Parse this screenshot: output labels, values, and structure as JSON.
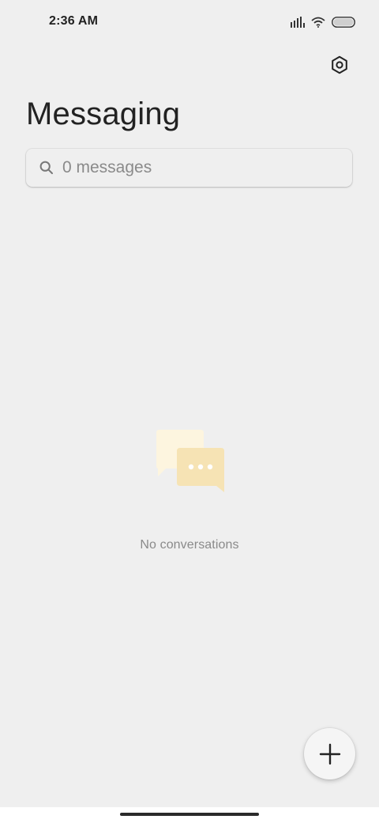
{
  "status_bar": {
    "time": "2:36 AM",
    "icons": [
      "signal-icon",
      "wifi-icon",
      "battery-icon"
    ]
  },
  "header": {
    "title": "Messaging",
    "settings_icon": "gear-icon"
  },
  "search": {
    "placeholder": "0 messages",
    "value": "",
    "icon": "search-icon"
  },
  "empty_state": {
    "text": "No conversations",
    "illustration": "chat-bubbles-icon"
  },
  "fab": {
    "icon": "plus-icon"
  },
  "colors": {
    "background": "#efefef",
    "bubble_back": "#fdf5df",
    "bubble_front": "#f6e3b4",
    "text_muted": "#8a8a8a"
  }
}
